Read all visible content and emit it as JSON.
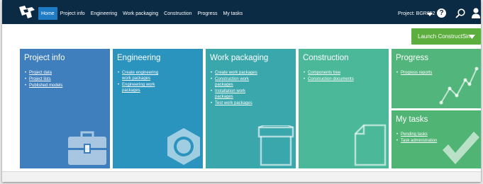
{
  "nav": {
    "items": [
      {
        "label": "Home",
        "active": true
      },
      {
        "label": "Project info",
        "active": false
      },
      {
        "label": "Engineering",
        "active": false
      },
      {
        "label": "Work packaging",
        "active": false
      },
      {
        "label": "Construction",
        "active": false
      },
      {
        "label": "Progress",
        "active": false
      },
      {
        "label": "My tasks",
        "active": false
      }
    ],
    "project_label": "Project: BGR852",
    "icons": [
      "logo-icon",
      "chevron-down-icon",
      "help-icon",
      "search-icon",
      "user-icon"
    ]
  },
  "launch_button": {
    "label": "Launch ConstructSim",
    "color": "#5cae3e"
  },
  "tiles": {
    "project_info": {
      "title": "Project info",
      "color": "#3f7fbe",
      "links": [
        "Project data",
        "Project lists",
        "Published models"
      ],
      "icon": "briefcase-icon"
    },
    "engineering": {
      "title": "Engineering",
      "color": "#2a93be",
      "links": [
        "Create engineering work packages",
        "Engineering work packages"
      ],
      "icon": "hex-nut-icon"
    },
    "work_packaging": {
      "title": "Work packaging",
      "color": "#3aa7ac",
      "links": [
        "Create work packages",
        "Construction work packages",
        "Installation work packages",
        "Test work packages"
      ],
      "icon": "box-icon"
    },
    "construction": {
      "title": "Construction",
      "color": "#4bb89a",
      "links": [
        "Components tree",
        "Construction documents"
      ],
      "icon": "document-icon"
    },
    "progress": {
      "title": "Progress",
      "color": "#52b67c",
      "links": [
        "Progress reports"
      ],
      "icon": "line-chart-icon"
    },
    "my_tasks": {
      "title": "My tasks",
      "color": "#50b475",
      "links": [
        "Pending tasks",
        "Task administration"
      ],
      "icon": "checkmark-icon"
    }
  }
}
